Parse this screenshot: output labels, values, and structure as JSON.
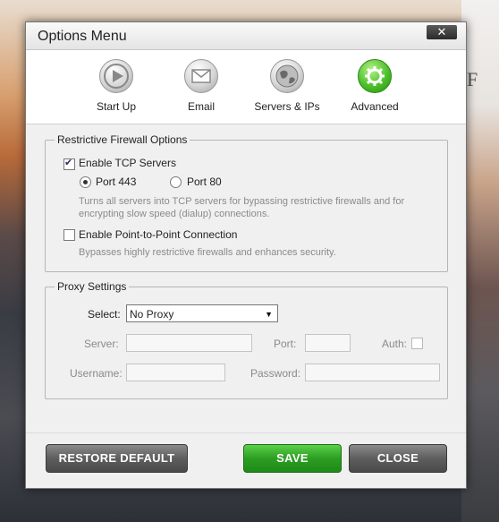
{
  "window": {
    "title": "Options Menu",
    "close_label": "✕"
  },
  "toolbar": {
    "items": [
      {
        "label": "Start Up",
        "icon": "play-icon"
      },
      {
        "label": "Email",
        "icon": "envelope-icon"
      },
      {
        "label": "Servers & IPs",
        "icon": "globe-icon"
      },
      {
        "label": "Advanced",
        "icon": "gear-icon",
        "active": true
      }
    ]
  },
  "firewall": {
    "legend": "Restrictive Firewall Options",
    "enable_tcp_label": "Enable TCP Servers",
    "enable_tcp_checked": true,
    "port443_label": "Port 443",
    "port443_selected": true,
    "port80_label": "Port 80",
    "tcp_desc": "Turns all servers into TCP servers for bypassing restrictive firewalls and for encrypting slow speed (dialup) connections.",
    "p2p_label": "Enable Point-to-Point Connection",
    "p2p_checked": false,
    "p2p_desc": "Bypasses highly restrictive firewalls and enhances security."
  },
  "proxy": {
    "legend": "Proxy Settings",
    "select_label": "Select:",
    "select_value": "No Proxy",
    "server_label": "Server:",
    "server_value": "",
    "port_label": "Port:",
    "port_value": "",
    "auth_label": "Auth:",
    "auth_checked": false,
    "username_label": "Username:",
    "username_value": "",
    "password_label": "Password:",
    "password_value": ""
  },
  "buttons": {
    "restore_label": "RESTORE DEFAULT",
    "save_label": "SAVE",
    "close_label": "CLOSE"
  },
  "colors": {
    "accent_green": "#2e9e22",
    "button_grey": "#5e5e5e"
  }
}
